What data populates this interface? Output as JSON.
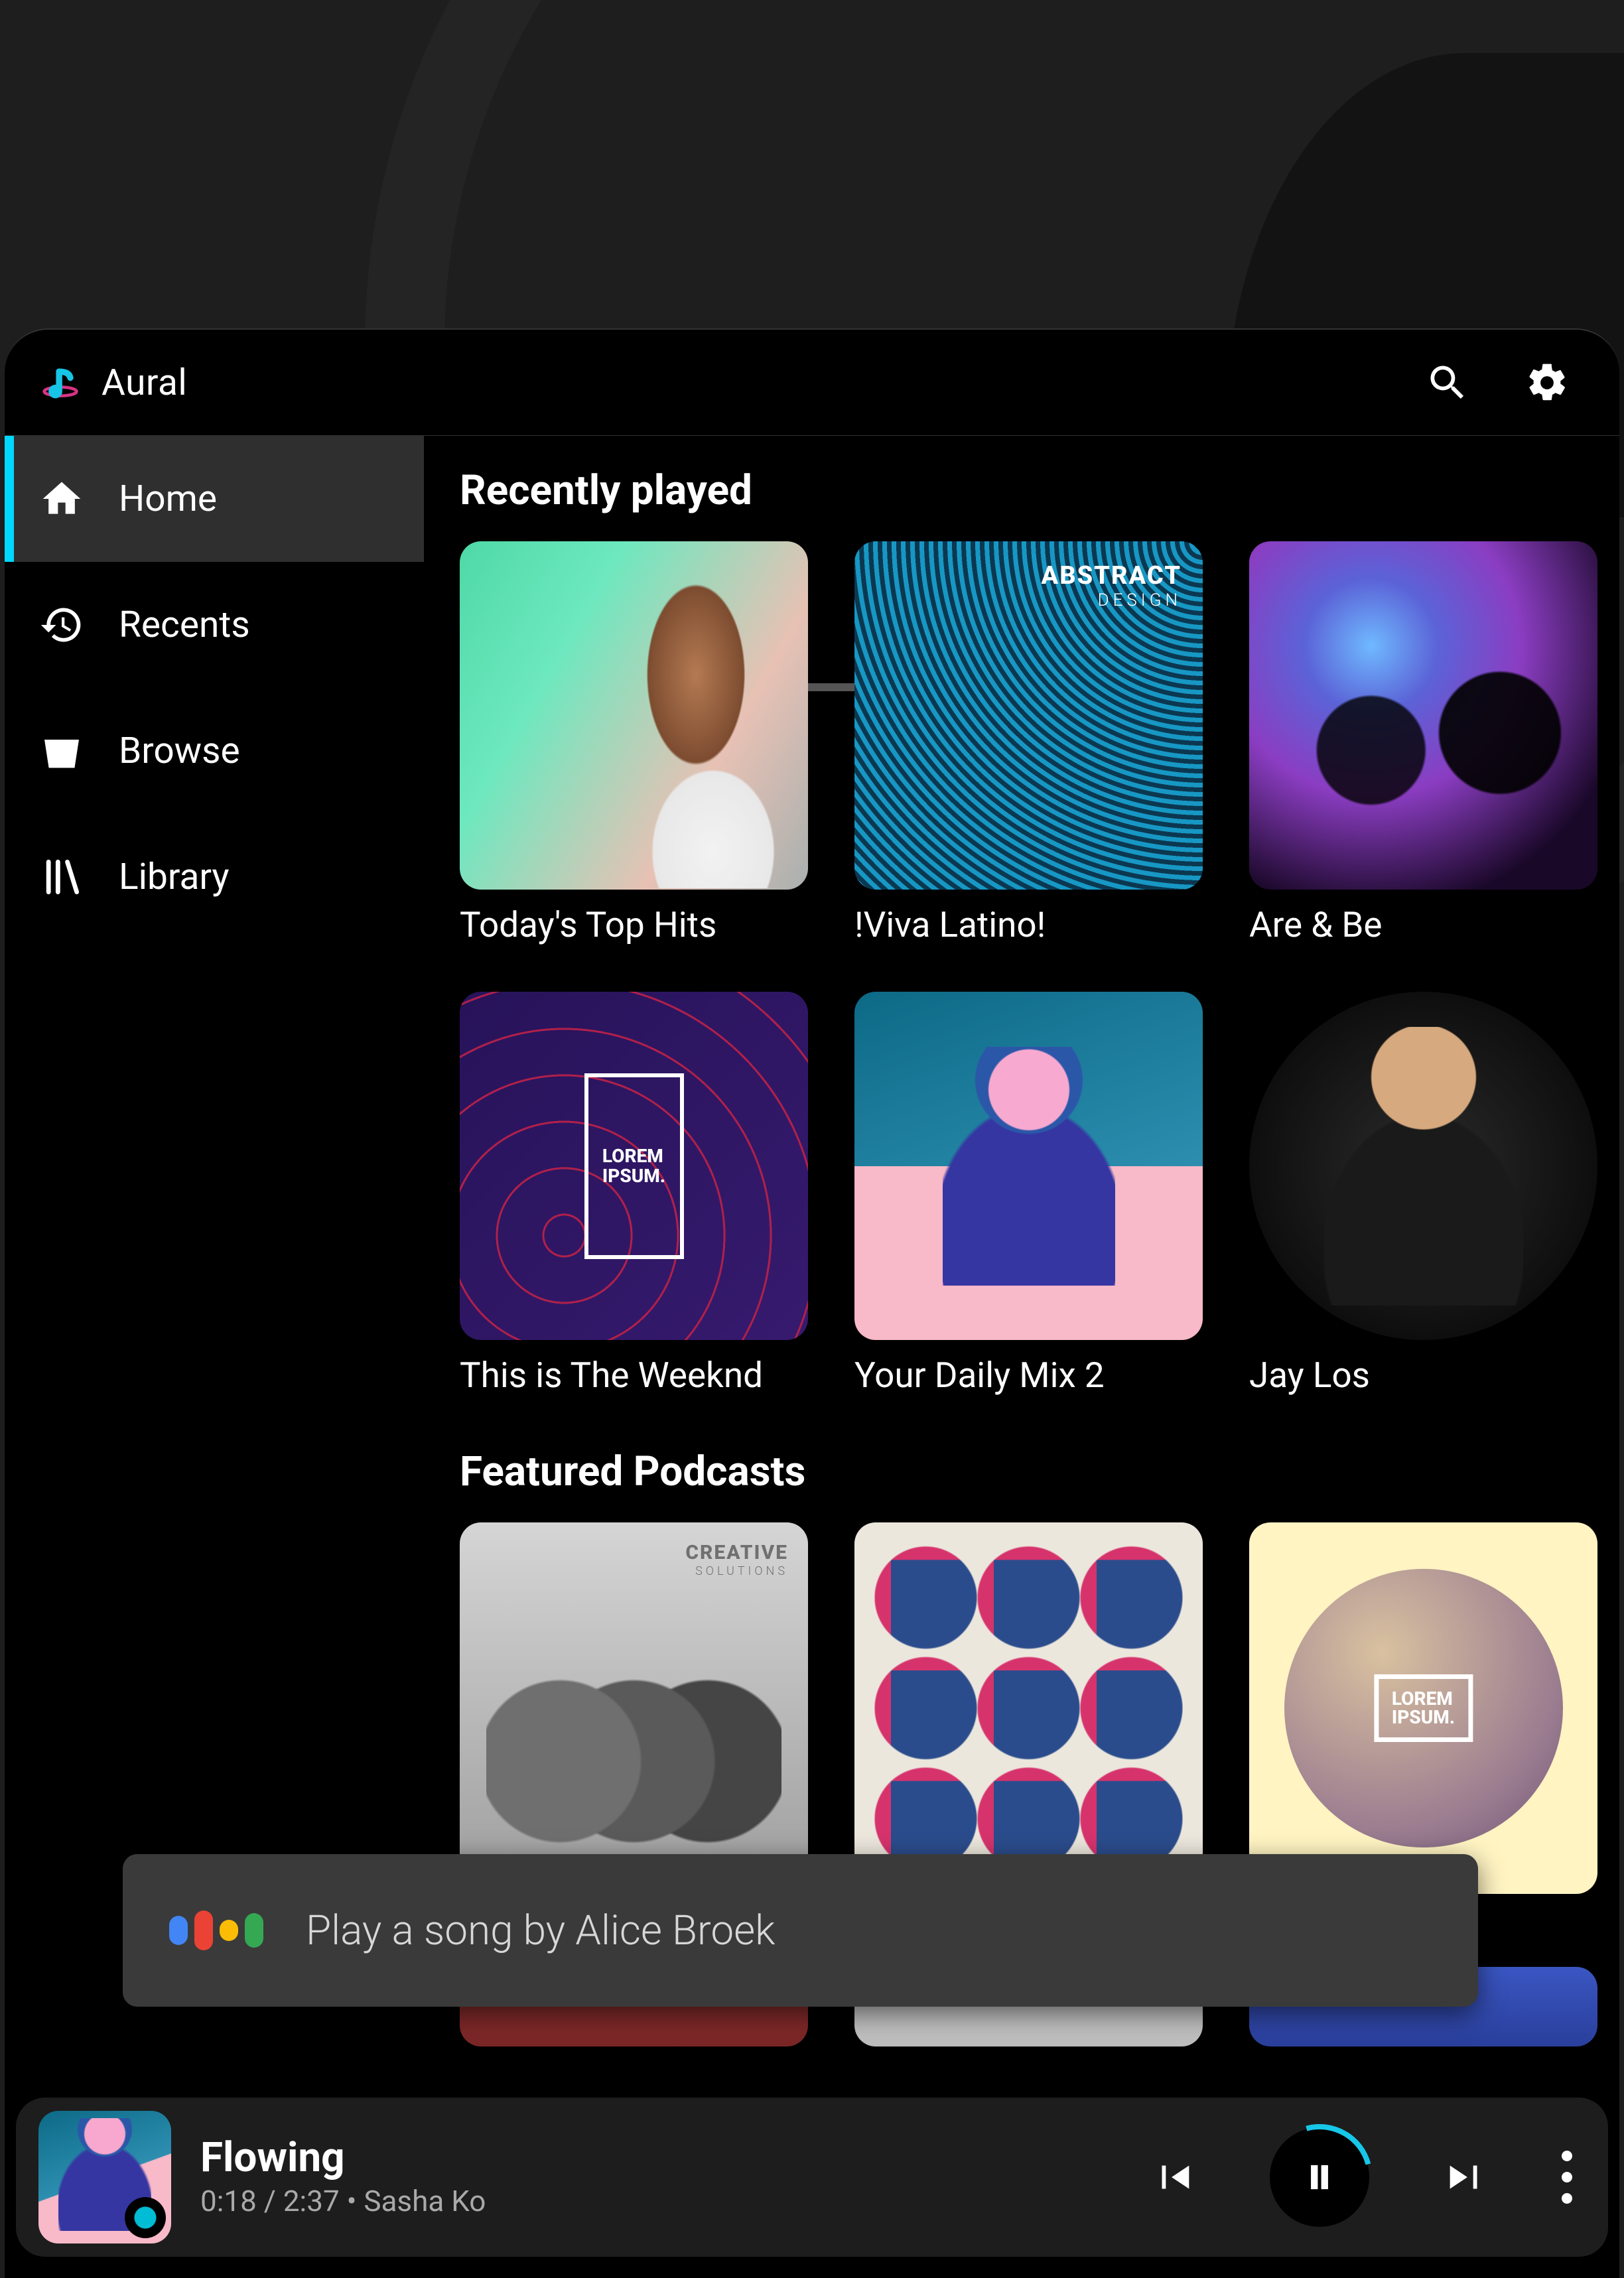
{
  "app_name": "Aural",
  "sidebar": {
    "items": [
      {
        "label": "Home",
        "icon": "home-icon",
        "active": true
      },
      {
        "label": "Recents",
        "icon": "history-icon",
        "active": false
      },
      {
        "label": "Browse",
        "icon": "browse-icon",
        "active": false
      },
      {
        "label": "Library",
        "icon": "library-icon",
        "active": false
      }
    ]
  },
  "sections": {
    "recently_played": {
      "title": "Recently played",
      "items": [
        {
          "label": "Today's Top Hits"
        },
        {
          "label": "!Viva Latino!",
          "overlay_line1": "ABSTRACT",
          "overlay_line2": "DESIGN"
        },
        {
          "label": "Are & Be"
        },
        {
          "label": "This is The Weeknd",
          "overlay_line1": "LOREM",
          "overlay_line2": "IPSUM."
        },
        {
          "label": "Your Daily Mix 2"
        },
        {
          "label": "Jay Los",
          "shape": "circle"
        }
      ]
    },
    "featured_podcasts": {
      "title": "Featured Podcasts",
      "items": [
        {
          "overlay_line1": "CREATIVE",
          "overlay_line2": "SOLUTIONS"
        },
        {},
        {
          "overlay_line1": "LOREM",
          "overlay_line2": "IPSUM."
        }
      ]
    }
  },
  "assistant": {
    "text": "Play a song by Alice Broek"
  },
  "now_playing": {
    "title": "Flowing",
    "elapsed": "0:18",
    "duration": "2:37",
    "separator": " / ",
    "dot": " • ",
    "artist": "Sasha Ko",
    "state": "playing"
  },
  "colors": {
    "accent": "#00d8ff",
    "assistant_dots": [
      "#4285F4",
      "#EA4335",
      "#FBBC05",
      "#34A853"
    ]
  }
}
